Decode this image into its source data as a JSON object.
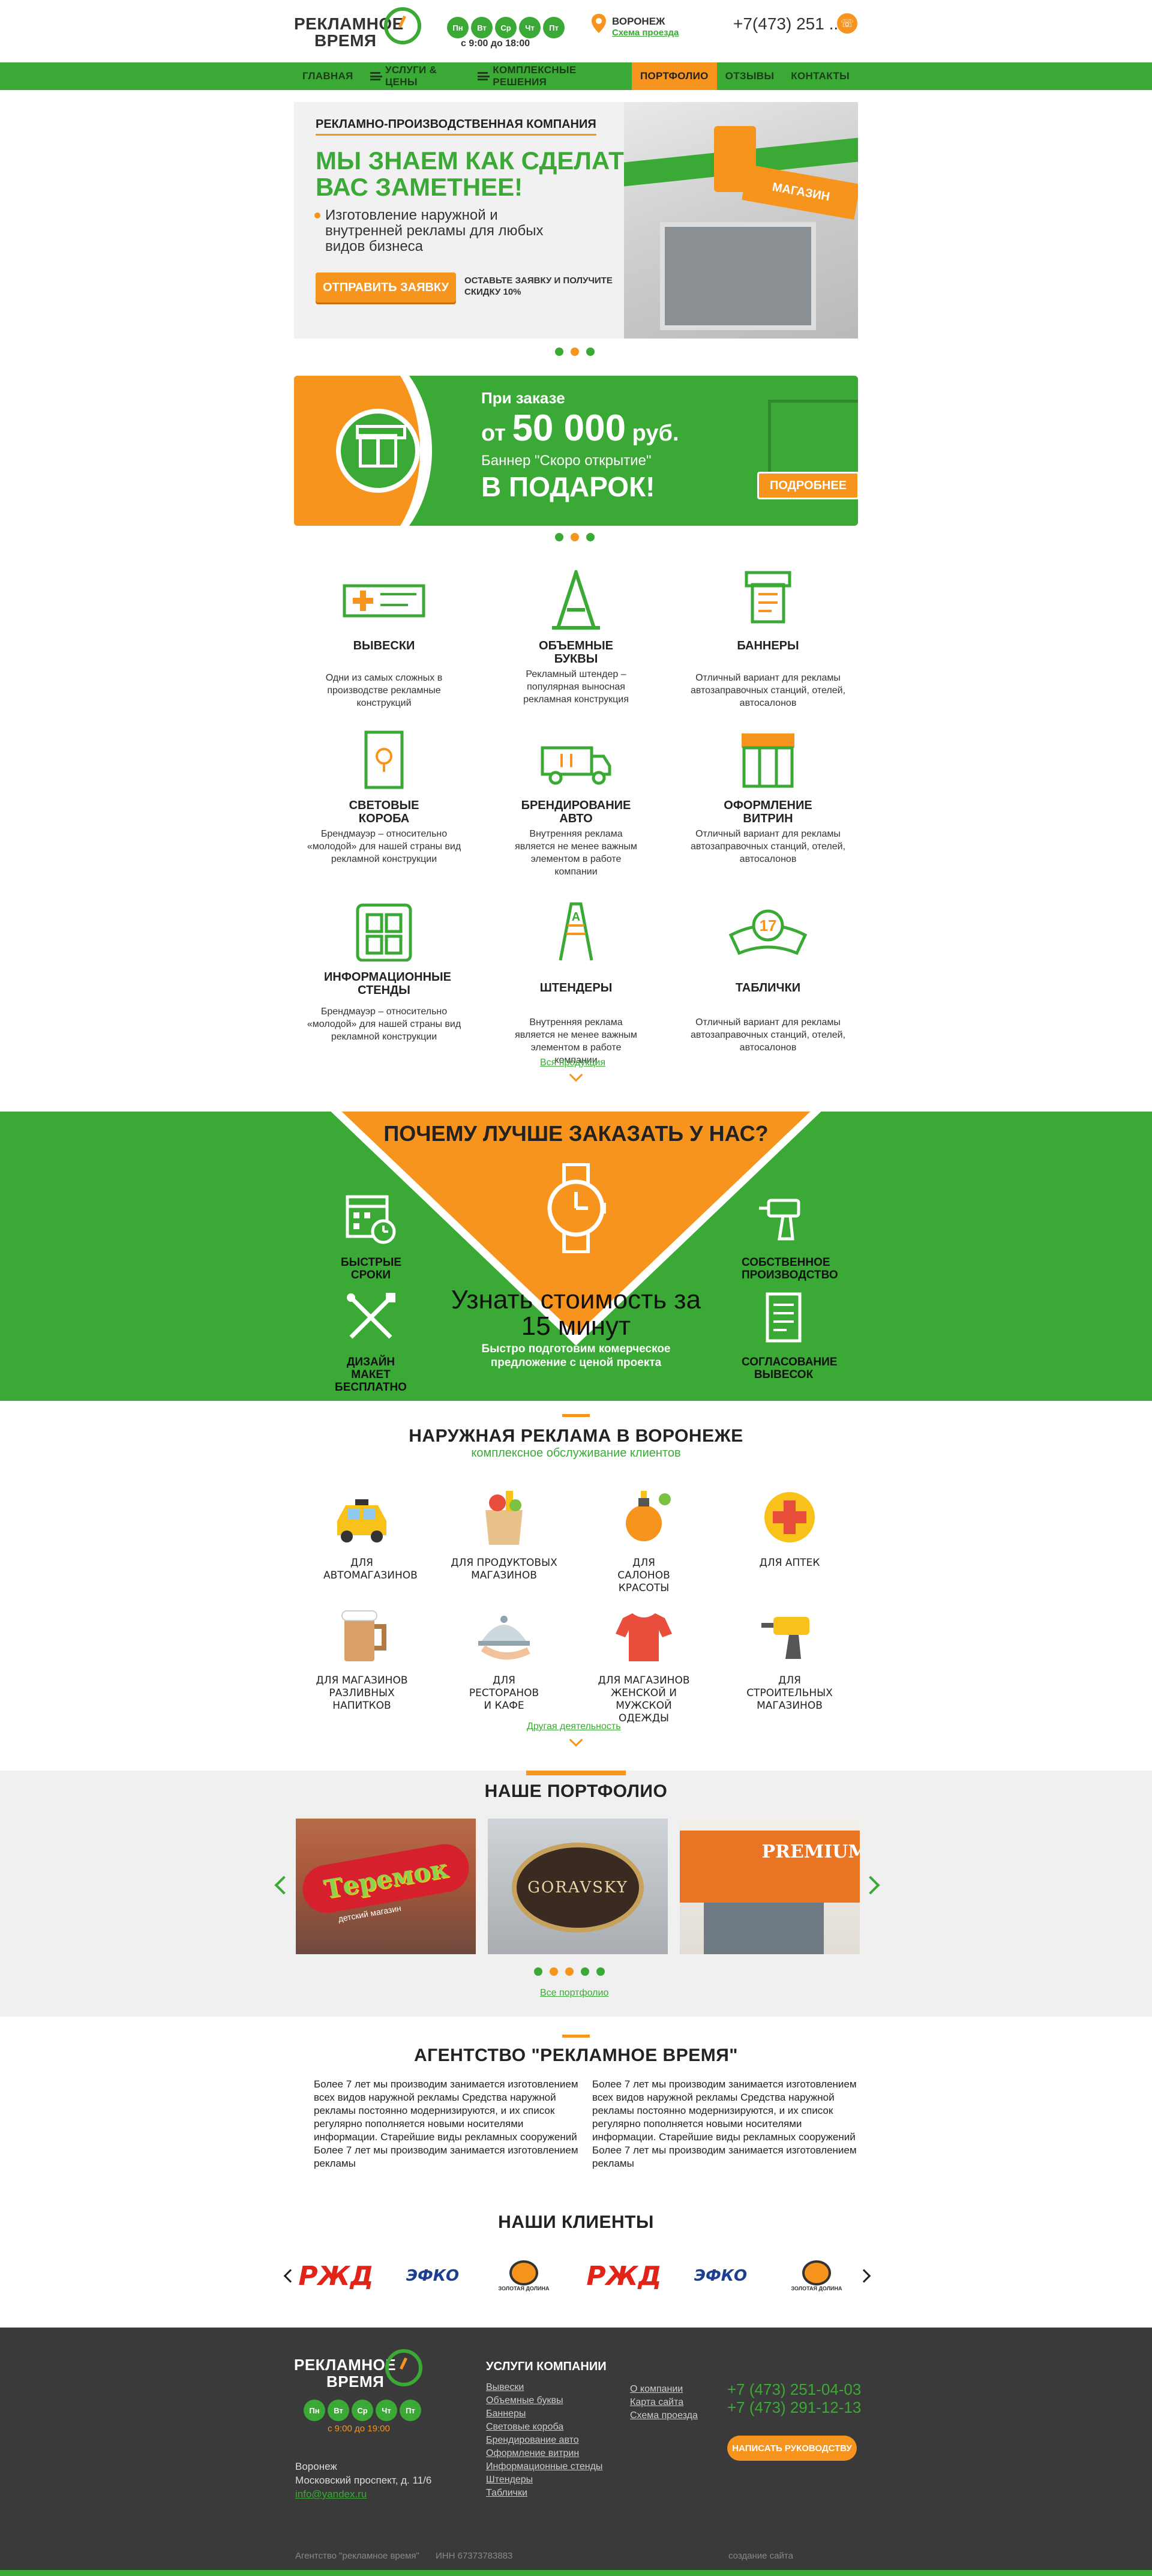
{
  "header": {
    "logo_line1": "РЕКЛАМНОЕ",
    "logo_line2": "ВРЕМЯ",
    "days": [
      "Пн",
      "Вт",
      "Ср",
      "Чт",
      "Пт"
    ],
    "hours": "с 9:00 до 18:00",
    "city": "ВОРОНЕЖ",
    "route_link": "Схема проезда",
    "phone": "+7(473) 251 ..",
    "colors": {
      "brand_green": "#3aa935",
      "accent_orange": "#f7941d"
    }
  },
  "nav": {
    "items": [
      {
        "label": "ГЛАВНАЯ",
        "burger": false,
        "active": false
      },
      {
        "label": "УСЛУГИ & ЦЕНЫ",
        "burger": true,
        "active": false
      },
      {
        "label": "КОМПЛЕКСНЫЕ РЕШЕНИЯ",
        "burger": true,
        "active": false
      },
      {
        "label": "ПОРТФОЛИО",
        "burger": false,
        "active": true
      },
      {
        "label": "ОТЗЫВЫ",
        "burger": false,
        "active": false
      },
      {
        "label": "КОНТАКТЫ",
        "burger": false,
        "active": false
      }
    ]
  },
  "hero": {
    "kicker": "РЕКЛАМНО-ПРОИЗВОДСТВЕННАЯ КОМПАНИЯ",
    "title": "МЫ ЗНАЕМ КАК СДЕЛАТЬ ВАС ЗАМЕТНЕЕ!",
    "text": "Изготовление наружной и внутренней рекламы для любых видов бизнеса",
    "button": "ОТПРАВИТЬ ЗАЯВКУ",
    "note": "ОСТАВЬТЕ ЗАЯВКУ И ПОЛУЧИТЕ СКИДКУ 10%",
    "photo_sign": "МАГАЗИН",
    "active_dot": 1
  },
  "promo": {
    "line1": "При заказе",
    "line2_prefix": "от",
    "line2_amount": "50 000",
    "line2_suffix": "руб.",
    "line3": "Баннер \"Скоро открытие\"",
    "line4": "В ПОДАРОК!",
    "button": "ПОДРОБНЕЕ",
    "active_dot": 1
  },
  "products": {
    "items": [
      {
        "title": "ВЫВЕСКИ",
        "desc": "Одни из самых сложных в производстве рекламные конструкций",
        "icon": "signboard-icon"
      },
      {
        "title": "ОБЪЕМНЫЕ БУКВЫ",
        "desc": "Рекламный штендер – популярная выносная рекламная конструкция",
        "icon": "letter-a-icon"
      },
      {
        "title": "БАННЕРЫ",
        "desc": "Отличный вариант для рекламы автозаправочных станций, отелей, автосалонов",
        "icon": "banner-printer-icon"
      },
      {
        "title": "СВЕТОВЫЕ КОРОБА",
        "desc": "Брендмауэр – относительно «молодой» для нашей страны вид рекламной конструкции",
        "icon": "lightbox-icon"
      },
      {
        "title": "БРЕНДИРОВАНИЕ АВТО",
        "desc": "Внутренняя реклама является не менее важным элементом в работе компании",
        "icon": "van-icon"
      },
      {
        "title": "ОФОРМЛЕНИЕ ВИТРИН",
        "desc": "Отличный вариант для рекламы автозаправочных станций, отелей, автосалонов",
        "icon": "storefront-icon"
      },
      {
        "title": "ИНФОРМАЦИОННЫЕ СТЕНДЫ",
        "desc": "Брендмауэр – относительно «молодой» для нашей страны вид рекламной конструкции",
        "icon": "info-stand-icon"
      },
      {
        "title": "ШТЕНДЕРЫ",
        "desc": "Внутренняя реклама является не менее важным элементом в работе компании",
        "icon": "a-frame-sign-icon"
      },
      {
        "title": "ТАБЛИЧКИ",
        "desc": "Отличный вариант для рекламы автозаправочных станций, отелей, автосалонов",
        "icon": "nameplate-icon"
      }
    ],
    "all_link": "Вся продукция"
  },
  "why": {
    "title": "ПОЧЕМУ ЛУЧШЕ ЗАКАЗАТЬ У НАС?",
    "items": [
      {
        "label": "БЫСТРЫЕ СРОКИ",
        "icon": "calendar-clock-icon"
      },
      {
        "label": "СОБСТВЕННОЕ ПРОИЗВОДСТВО",
        "icon": "drill-icon"
      },
      {
        "label": "ДИЗАЙН МАКЕТ БЕСПЛАТНО",
        "icon": "design-tools-icon"
      },
      {
        "label": "СОГЛАСОВАНИЕ ВЫВЕСОК",
        "icon": "document-icon"
      }
    ],
    "center_title": "Узнать стоимость за 15 минут",
    "center_text": "Быстро подготовим комерческое предложение с ценой проекта"
  },
  "outdoor": {
    "title": "НАРУЖНАЯ РЕКЛАМА В ВОРОНЕЖЕ",
    "subtitle": "комплексное обслуживание клиентов",
    "items": [
      {
        "label": "ДЛЯ АВТОМАГАЗИНОВ",
        "icon": "taxi-icon"
      },
      {
        "label": "ДЛЯ ПРОДУКТОВЫХ МАГАЗИНОВ",
        "icon": "grocery-bag-icon"
      },
      {
        "label": "ДЛЯ САЛОНОВ КРАСОТЫ",
        "icon": "perfume-icon"
      },
      {
        "label": "ДЛЯ АПТЕК",
        "icon": "pharmacy-cross-icon"
      },
      {
        "label": "ДЛЯ МАГАЗИНОВ РАЗЛИВНЫХ НАПИТКОВ",
        "icon": "beer-mug-icon"
      },
      {
        "label": "ДЛЯ РЕСТОРАНОВ И КАФЕ",
        "icon": "cloche-icon"
      },
      {
        "label": "ДЛЯ МАГАЗИНОВ ЖЕНСКОЙ И МУЖСКОЙ ОДЕЖДЫ",
        "icon": "shirt-icon"
      },
      {
        "label": "ДЛЯ СТРОИТЕЛЬНЫХ МАГАЗИНОВ",
        "icon": "drill-icon"
      }
    ],
    "more_link": "Другая деятельность"
  },
  "portfolio": {
    "title": "НАШЕ ПОРТФОЛИО",
    "items": [
      {
        "sign": "Теремок",
        "sub": "детский магазин"
      },
      {
        "sign": "GORAVSKY",
        "sub": ""
      },
      {
        "sign": "PREMIUM",
        "sub": ""
      }
    ],
    "all_link": "Все портфолио",
    "dots": 5,
    "active_dots": [
      1,
      2
    ]
  },
  "agency": {
    "title": "АГЕНТСТВО \"РЕКЛАМНОЕ ВРЕМЯ\"",
    "col1": "Более 7 лет мы производим занимается изготовлением всех видов наружной рекламы Средства наружной рекламы постоянно модернизируются, и их список регулярно пополняется новыми носителями информации. Старейшие виды рекламных сооружений Более 7 лет мы производим занимается изготовлением рекламы",
    "col2": "Более 7 лет мы производим занимается изготовлением всех видов наружной рекламы Средства наружной рекламы постоянно модернизируются, и их список регулярно пополняется новыми носителями информации. Старейшие виды рекламных сооружений Более 7 лет мы производим занимается изготовлением рекламы"
  },
  "clients": {
    "title": "НАШИ КЛИЕНТЫ",
    "logos": [
      "РЖД",
      "ЭФКО",
      "ЗОЛОТАЯ ДОЛИНА",
      "РЖД",
      "ЭФКО",
      "ЗОЛОТАЯ ДОЛИНА"
    ]
  },
  "footer": {
    "logo_line1": "РЕКЛАМНОЕ",
    "logo_line2": "ВРЕМЯ",
    "days": [
      "Пн",
      "Вт",
      "Ср",
      "Чт",
      "Пт"
    ],
    "hours": "с 9:00 до 19:00",
    "city": "Воронеж",
    "address": "Московский проспект, д. 11/6",
    "email": "info@yandex.ru",
    "services_title": "УСЛУГИ КОМПАНИИ",
    "services": [
      "Вывески",
      "Объемные буквы",
      "Баннеры",
      "Световые короба",
      "Брендирование авто",
      "Оформление витрин",
      "Информационные стенды",
      "Штендеры",
      "Таблички"
    ],
    "links": [
      "О компании",
      "Карта сайта",
      "Схема проезда"
    ],
    "phone1": "+7 (473) 251-04-03",
    "phone2": "+7 (473) 291-12-13",
    "button": "НАПИСАТЬ РУКОВОДСТВУ",
    "copyright": "Агентство \"рекламное время\"",
    "inn": "ИНН 67373783883",
    "credit": "создание сайта"
  }
}
